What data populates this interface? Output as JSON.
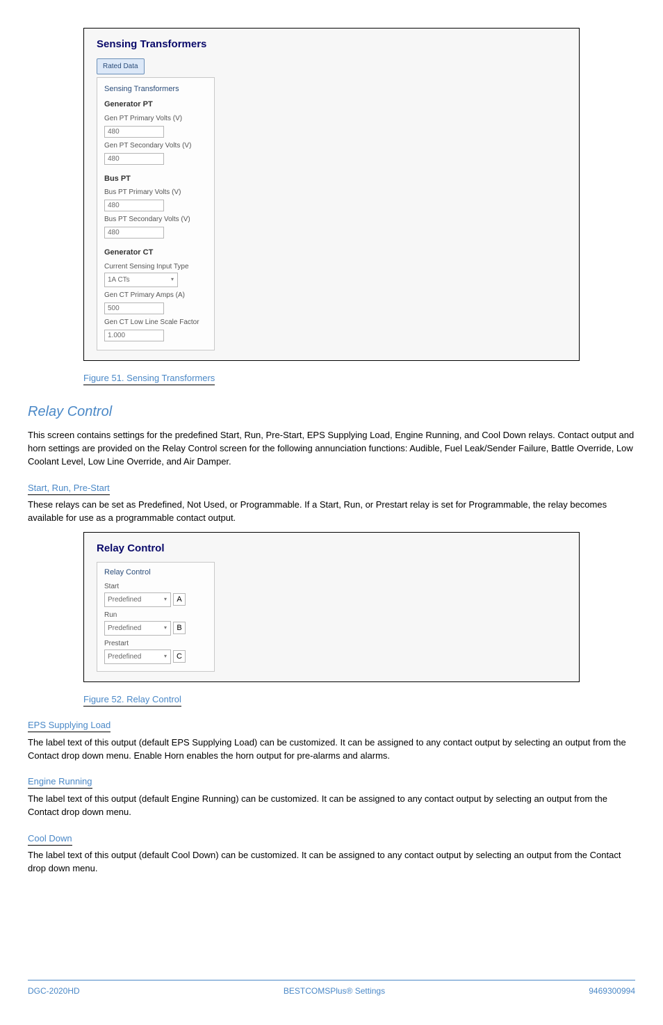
{
  "panel1": {
    "title": "Sensing Transformers",
    "tab": "Rated Data",
    "sectionHeader": "Sensing Transformers",
    "groups": {
      "genPT": {
        "header": "Generator PT",
        "f1": {
          "label": "Gen PT Primary Volts (V)",
          "value": "480"
        },
        "f2": {
          "label": "Gen PT Secondary Volts (V)",
          "value": "480"
        }
      },
      "busPT": {
        "header": "Bus PT",
        "f1": {
          "label": "Bus PT Primary Volts (V)",
          "value": "480"
        },
        "f2": {
          "label": "Bus PT Secondary Volts (V)",
          "value": "480"
        }
      },
      "genCT": {
        "header": "Generator CT",
        "typeLabel": "Current Sensing Input Type",
        "typeValue": "1A CTs",
        "f1": {
          "label": "Gen CT Primary Amps (A)",
          "value": "500"
        },
        "f2": {
          "label": "Gen CT Low Line Scale Factor",
          "value": "1.000"
        }
      }
    }
  },
  "figure1": "Figure 51. Sensing Transformers",
  "sectionTitle": "Relay Control",
  "para1": "This screen contains settings for the predefined Start, Run, Pre-Start, EPS Supplying Load, Engine Running, and Cool Down relays. Contact output and horn settings are provided on the Relay Control screen for the following annunciation functions: Audible, Fuel Leak/Sender Failure, Battle Override, Low Coolant Level, Low Line Override, and Air Damper.",
  "sub1": {
    "title": "Start, Run, Pre-Start",
    "text": "These relays can be set as Predefined, Not Used, or Programmable. If a Start, Run, or Prestart relay is set for Programmable, the relay becomes available for use as a programmable contact output."
  },
  "panel2": {
    "title": "Relay Control",
    "sectionHeader": "Relay Control",
    "start": {
      "label": "Start",
      "value": "Predefined",
      "letter": "A"
    },
    "run": {
      "label": "Run",
      "value": "Predefined",
      "letter": "B"
    },
    "prestart": {
      "label": "Prestart",
      "value": "Predefined",
      "letter": "C"
    }
  },
  "figure2": "Figure 52. Relay Control",
  "sub2": {
    "title": "EPS Supplying Load",
    "text": "The label text of this output (default EPS Supplying Load) can be customized. It can be assigned to any contact output by selecting an output from the Contact drop down menu. Enable Horn enables the horn output for pre-alarms and alarms."
  },
  "sub3": {
    "title": "Engine Running",
    "text": "The label text of this output (default Engine Running) can be customized. It can be assigned to any contact output by selecting an output from the Contact drop down menu."
  },
  "sub4": {
    "title": "Cool Down",
    "text": "The label text of this output (default Cool Down) can be customized. It can be assigned to any contact output by selecting an output from the Contact drop down menu."
  },
  "footer": {
    "left": "DGC-2020HD",
    "center": "BESTCOMSPlus® Settings",
    "right": "9469300994"
  }
}
